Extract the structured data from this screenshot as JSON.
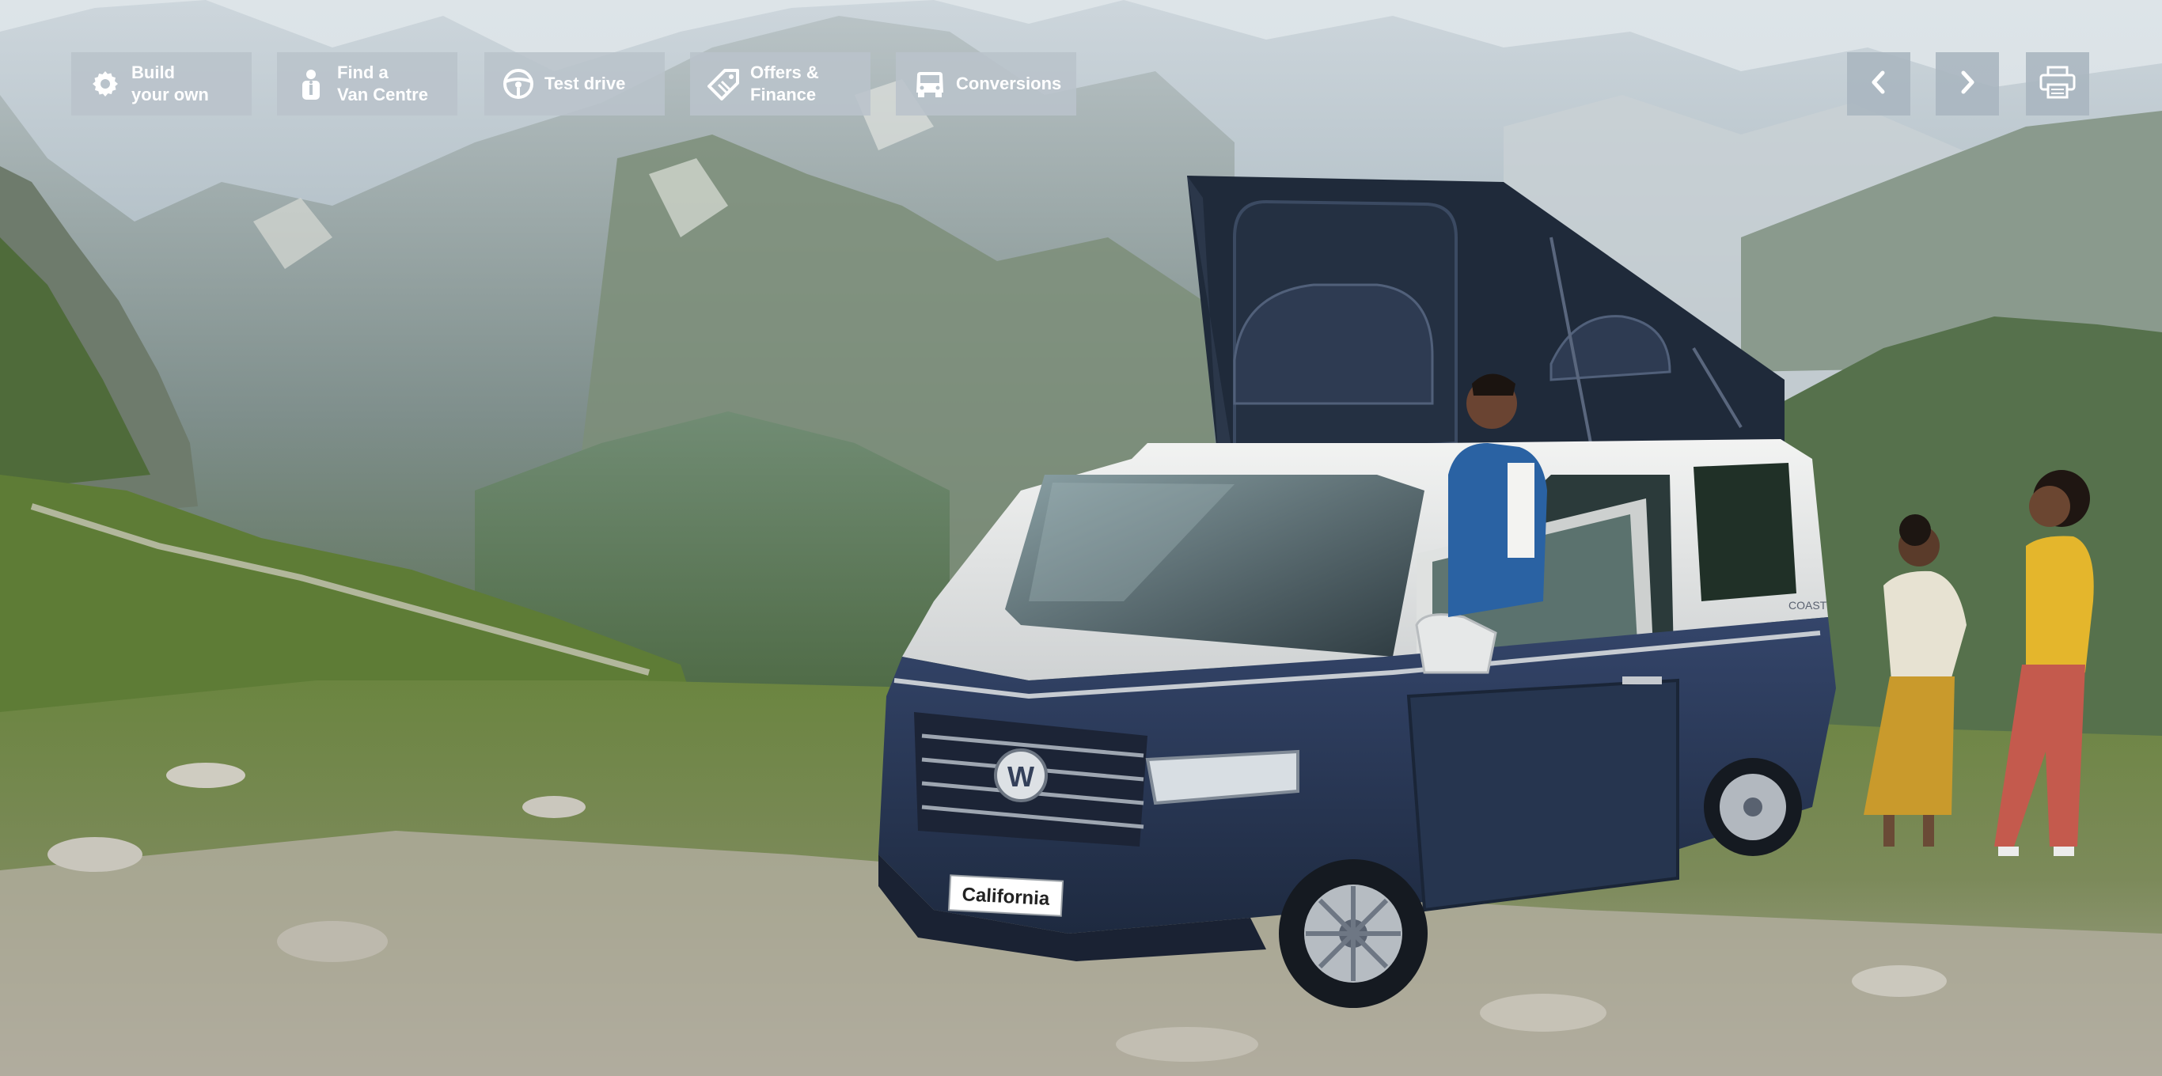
{
  "nav": {
    "items": [
      {
        "label": "Build\nyour own",
        "icon": "gear-icon"
      },
      {
        "label": "Find a\nVan Centre",
        "icon": "info-person-icon"
      },
      {
        "label": "Test drive",
        "icon": "steering-wheel-icon"
      },
      {
        "label": "Offers &\nFinance",
        "icon": "price-tag-icon"
      },
      {
        "label": "Conversions",
        "icon": "van-icon"
      }
    ]
  },
  "controls": {
    "prev": "chevron-left-icon",
    "next": "chevron-right-icon",
    "print": "printer-icon"
  },
  "hero": {
    "number_plate": "California",
    "rear_badge": "COAST",
    "colors": {
      "sky": "#dfe6ea",
      "grass": "#6f8b3e",
      "van_upper": "#e8e9e8",
      "van_lower": "#27364f",
      "roof": "#1f2a3a"
    }
  }
}
